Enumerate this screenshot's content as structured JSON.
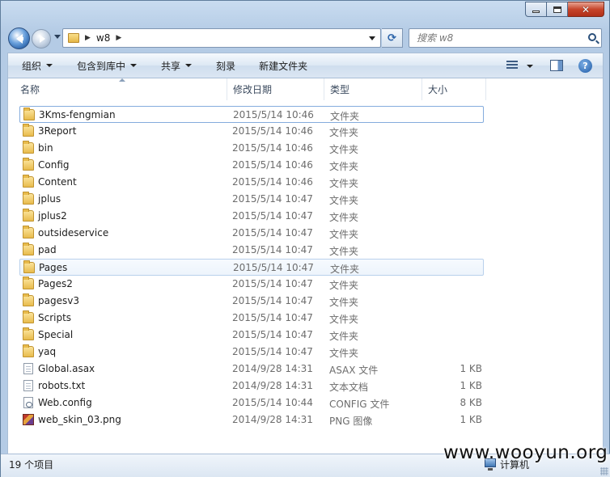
{
  "window": {
    "address_path": [
      "w8"
    ],
    "search_placeholder": "搜索 w8"
  },
  "toolbar": {
    "organize": "组织",
    "include_in_library": "包含到库中",
    "share": "共享",
    "burn": "刻录",
    "new_folder": "新建文件夹"
  },
  "columns": {
    "name": "名称",
    "modified": "修改日期",
    "type": "类型",
    "size": "大小"
  },
  "files": [
    {
      "name": "3Kms-fengmian",
      "modified": "2015/5/14 10:46",
      "type": "文件夹",
      "size": "",
      "icon": "folder-icon"
    },
    {
      "name": "3Report",
      "modified": "2015/5/14 10:46",
      "type": "文件夹",
      "size": "",
      "icon": "folder-icon"
    },
    {
      "name": "bin",
      "modified": "2015/5/14 10:46",
      "type": "文件夹",
      "size": "",
      "icon": "folder-icon"
    },
    {
      "name": "Config",
      "modified": "2015/5/14 10:46",
      "type": "文件夹",
      "size": "",
      "icon": "folder-icon"
    },
    {
      "name": "Content",
      "modified": "2015/5/14 10:46",
      "type": "文件夹",
      "size": "",
      "icon": "folder-icon"
    },
    {
      "name": "jplus",
      "modified": "2015/5/14 10:47",
      "type": "文件夹",
      "size": "",
      "icon": "folder-icon"
    },
    {
      "name": "jplus2",
      "modified": "2015/5/14 10:47",
      "type": "文件夹",
      "size": "",
      "icon": "folder-icon"
    },
    {
      "name": "outsideservice",
      "modified": "2015/5/14 10:47",
      "type": "文件夹",
      "size": "",
      "icon": "folder-icon"
    },
    {
      "name": "pad",
      "modified": "2015/5/14 10:47",
      "type": "文件夹",
      "size": "",
      "icon": "folder-icon"
    },
    {
      "name": "Pages",
      "modified": "2015/5/14 10:47",
      "type": "文件夹",
      "size": "",
      "icon": "folder-icon"
    },
    {
      "name": "Pages2",
      "modified": "2015/5/14 10:47",
      "type": "文件夹",
      "size": "",
      "icon": "folder-icon"
    },
    {
      "name": "pagesv3",
      "modified": "2015/5/14 10:47",
      "type": "文件夹",
      "size": "",
      "icon": "folder-icon"
    },
    {
      "name": "Scripts",
      "modified": "2015/5/14 10:47",
      "type": "文件夹",
      "size": "",
      "icon": "folder-icon"
    },
    {
      "name": "Special",
      "modified": "2015/5/14 10:47",
      "type": "文件夹",
      "size": "",
      "icon": "folder-icon"
    },
    {
      "name": "yaq",
      "modified": "2015/5/14 10:47",
      "type": "文件夹",
      "size": "",
      "icon": "folder-icon"
    },
    {
      "name": "Global.asax",
      "modified": "2014/9/28 14:31",
      "type": "ASAX 文件",
      "size": "1 KB",
      "icon": "file-icon"
    },
    {
      "name": "robots.txt",
      "modified": "2014/9/28 14:31",
      "type": "文本文档",
      "size": "1 KB",
      "icon": "text-file-icon"
    },
    {
      "name": "Web.config",
      "modified": "2015/5/14 10:44",
      "type": "CONFIG 文件",
      "size": "8 KB",
      "icon": "config-file-icon"
    },
    {
      "name": "web_skin_03.png",
      "modified": "2014/9/28 14:31",
      "type": "PNG 图像",
      "size": "1 KB",
      "icon": "image-file-icon"
    }
  ],
  "status": {
    "item_count": "19 个项目",
    "location": "计算机"
  },
  "watermark": "www.wooyun.org"
}
